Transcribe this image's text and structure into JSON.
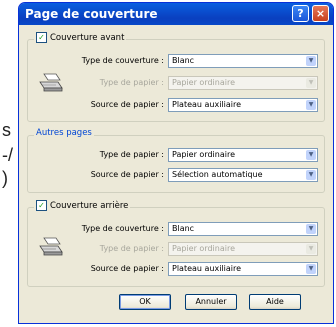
{
  "background_fragments": [
    "s",
    "-/",
    ")"
  ],
  "window": {
    "title": "Page de couverture",
    "help_label": "?",
    "close_label": "×"
  },
  "front_cover": {
    "checkbox_label": "Couverture avant",
    "checked": true,
    "type_label": "Type de couverture :",
    "type_value": "Blanc",
    "paper_type_label": "Type de papier :",
    "paper_type_value": "Papier ordinaire",
    "paper_source_label": "Source de papier :",
    "paper_source_value": "Plateau auxiliaire"
  },
  "other_pages": {
    "legend": "Autres pages",
    "paper_type_label": "Type de papier :",
    "paper_type_value": "Papier ordinaire",
    "paper_source_label": "Source de papier :",
    "paper_source_value": "Sélection automatique"
  },
  "back_cover": {
    "checkbox_label": "Couverture arrière",
    "checked": true,
    "type_label": "Type de couverture :",
    "type_value": "Blanc",
    "paper_type_label": "Type de papier :",
    "paper_type_value": "Papier ordinaire",
    "paper_source_label": "Source de papier :",
    "paper_source_value": "Plateau auxiliaire"
  },
  "buttons": {
    "ok": "OK",
    "cancel": "Annuler",
    "help": "Aide"
  },
  "colors": {
    "titlebar": "#0a5fe0",
    "dialog_bg": "#ece9d8",
    "group_legend_blue": "#0046d5"
  }
}
